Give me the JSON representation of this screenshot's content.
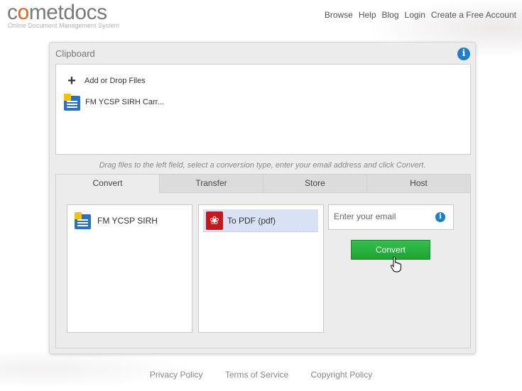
{
  "brand": {
    "logo_prefix": "c",
    "logo_o": "o",
    "logo_suffix": "metdocs",
    "tagline": "Online Document Management System",
    "accent": "#e2641d"
  },
  "topnav": [
    "Browse",
    "Help",
    "Blog",
    "Login",
    "Create a Free Account"
  ],
  "clipboard": {
    "title": "Clipboard",
    "add_label": "Add or Drop Files",
    "file_name": "FM YCSP SIRH Carr..."
  },
  "hint": "Drag files to the left field, select a conversion type, enter your email address and click Convert.",
  "tabs": [
    {
      "label": "Convert",
      "active": true
    },
    {
      "label": "Transfer",
      "active": false
    },
    {
      "label": "Store",
      "active": false
    },
    {
      "label": "Host",
      "active": false
    }
  ],
  "convert": {
    "source_file": "FM YCSP SIRH",
    "format_selected": "To PDF (pdf)",
    "email_placeholder": "Enter your email",
    "button_label": "Convert",
    "button_color": "#22a83a"
  },
  "footer": [
    "Privacy Policy",
    "Terms of Service",
    "Copyright Policy"
  ]
}
